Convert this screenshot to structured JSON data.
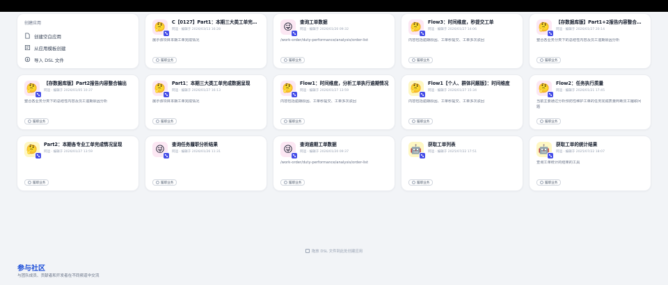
{
  "create": {
    "title": "创建应用",
    "items": [
      {
        "label": "创建空白应用",
        "icon": "file-icon"
      },
      {
        "label": "从应用模板创建",
        "icon": "template-icon"
      },
      {
        "label": "导入 DSL 文件",
        "icon": "import-icon"
      }
    ]
  },
  "cards": [
    {
      "title": "C【0127】Part1：本期三大类工单完成数据呈现",
      "meta": "阿运 · 编辑于 2026/03/13 16:28",
      "desc": "展示该项目本期工单完成情况",
      "tag": "履职业务",
      "icon": "emoji-thinking",
      "bg": "pink"
    },
    {
      "title": "查询工单数据",
      "meta": "阿运 · 编辑于 2026/01/20 09:32",
      "desc": "/work-order/duty-performance/analysis/order-list",
      "tag": "履职业务",
      "icon": "emoji-wink",
      "bg": "pink"
    },
    {
      "title": "Flow3：时间维度，秒提交工单",
      "meta": "阿运 · 编辑于 2026/01/27 14:06",
      "desc": "内容包括逾期原因、工单秒提交、工单多次驳回",
      "tag": "履职业务",
      "icon": "emoji-thinking",
      "bg": "pink"
    },
    {
      "title": "【存数据库版】Part1+2报告内容整合输出",
      "meta": "阿运 · 编辑于 2026/01/27 20:14",
      "desc": "整合各业务分类下的总结性内容及员工逾期原因分析",
      "tag": "履职业务",
      "icon": "emoji-thinking",
      "bg": "pink"
    },
    {
      "title": "【存数据库版】Part2报告内容整合输出",
      "meta": "阿运 · 编辑于 2026/01/05 10:37",
      "desc": "整合各业务分类下的总结性内容及员工逾期原因分析",
      "tag": "履职业务",
      "icon": "emoji-thinking",
      "bg": "pink"
    },
    {
      "title": "Part1：本期三大类工单完成数据呈现",
      "meta": "阿运 · 编辑于 2026/01/27 16:13",
      "desc": "展示该项目本期工单完成情况",
      "tag": "履职业务",
      "icon": "emoji-thinking",
      "bg": "pink"
    },
    {
      "title": "Flow1：时间维度，分析工单执行逾期情况",
      "meta": "阿运 · 编辑于 2026/01/27 13:59",
      "desc": "内容包括逾期原因、工单秒提交、工单多次驳回",
      "tag": "履职业务",
      "icon": "emoji-thinking",
      "bg": "pink"
    },
    {
      "title": "Flow1【个人、群体问题版】：时间维度",
      "meta": "阿运 · 编辑于 2026/01/27 15:34",
      "desc": "内容包括逾期原因、工单秒提交、工单多次驳回",
      "tag": "履职业务",
      "icon": "emoji-thinking",
      "bg": "yellow"
    },
    {
      "title": "Flow2：任务执行质量",
      "meta": "阿运 · 编辑于 2026/01/21 17:45",
      "desc": "当前主要通过分析预防性维护工单的任务完成质量判断员工履职问题",
      "tag": "履职业务",
      "icon": "emoji-thinking",
      "bg": "pink"
    },
    {
      "title": "Part2：本期各专业工单完成情况呈现",
      "meta": "阿运 · 编辑于 2026/01/27 13:59",
      "desc": "",
      "tag": "履职业务",
      "icon": "emoji-thinking",
      "bg": "yellow"
    },
    {
      "title": "查询任务履职分析结果",
      "meta": "阿运 · 编辑于 2026/01/26 11:31",
      "desc": "",
      "tag": "履职业务",
      "icon": "emoji-wink",
      "bg": "pink"
    },
    {
      "title": "查询逾期工单数据",
      "meta": "阿运 · 编辑于 2026/01/20 09:37",
      "desc": "/work-order/duty-performance/analysis/order-list",
      "tag": "履职业务",
      "icon": "emoji-wink",
      "bg": "pink"
    },
    {
      "title": "获取工单列表",
      "meta": "阿运 · 编辑于 2025/07/22 17:51",
      "desc": "",
      "tag": "履职业务",
      "icon": "emoji-robot",
      "bg": "yellow"
    },
    {
      "title": "获取工单的统计结果",
      "meta": "阿运 · 编辑于 2025/07/22 18:07",
      "desc": "查询工单统计的结果的工具",
      "tag": "履职业务",
      "icon": "emoji-robot",
      "bg": "yellow"
    }
  ],
  "dropzone": "拖放 DSL 文件到此处创建应用",
  "community": {
    "title": "参与社区",
    "subtitle": "与团队成员、贡献者和开发者在不同频道中交流"
  }
}
